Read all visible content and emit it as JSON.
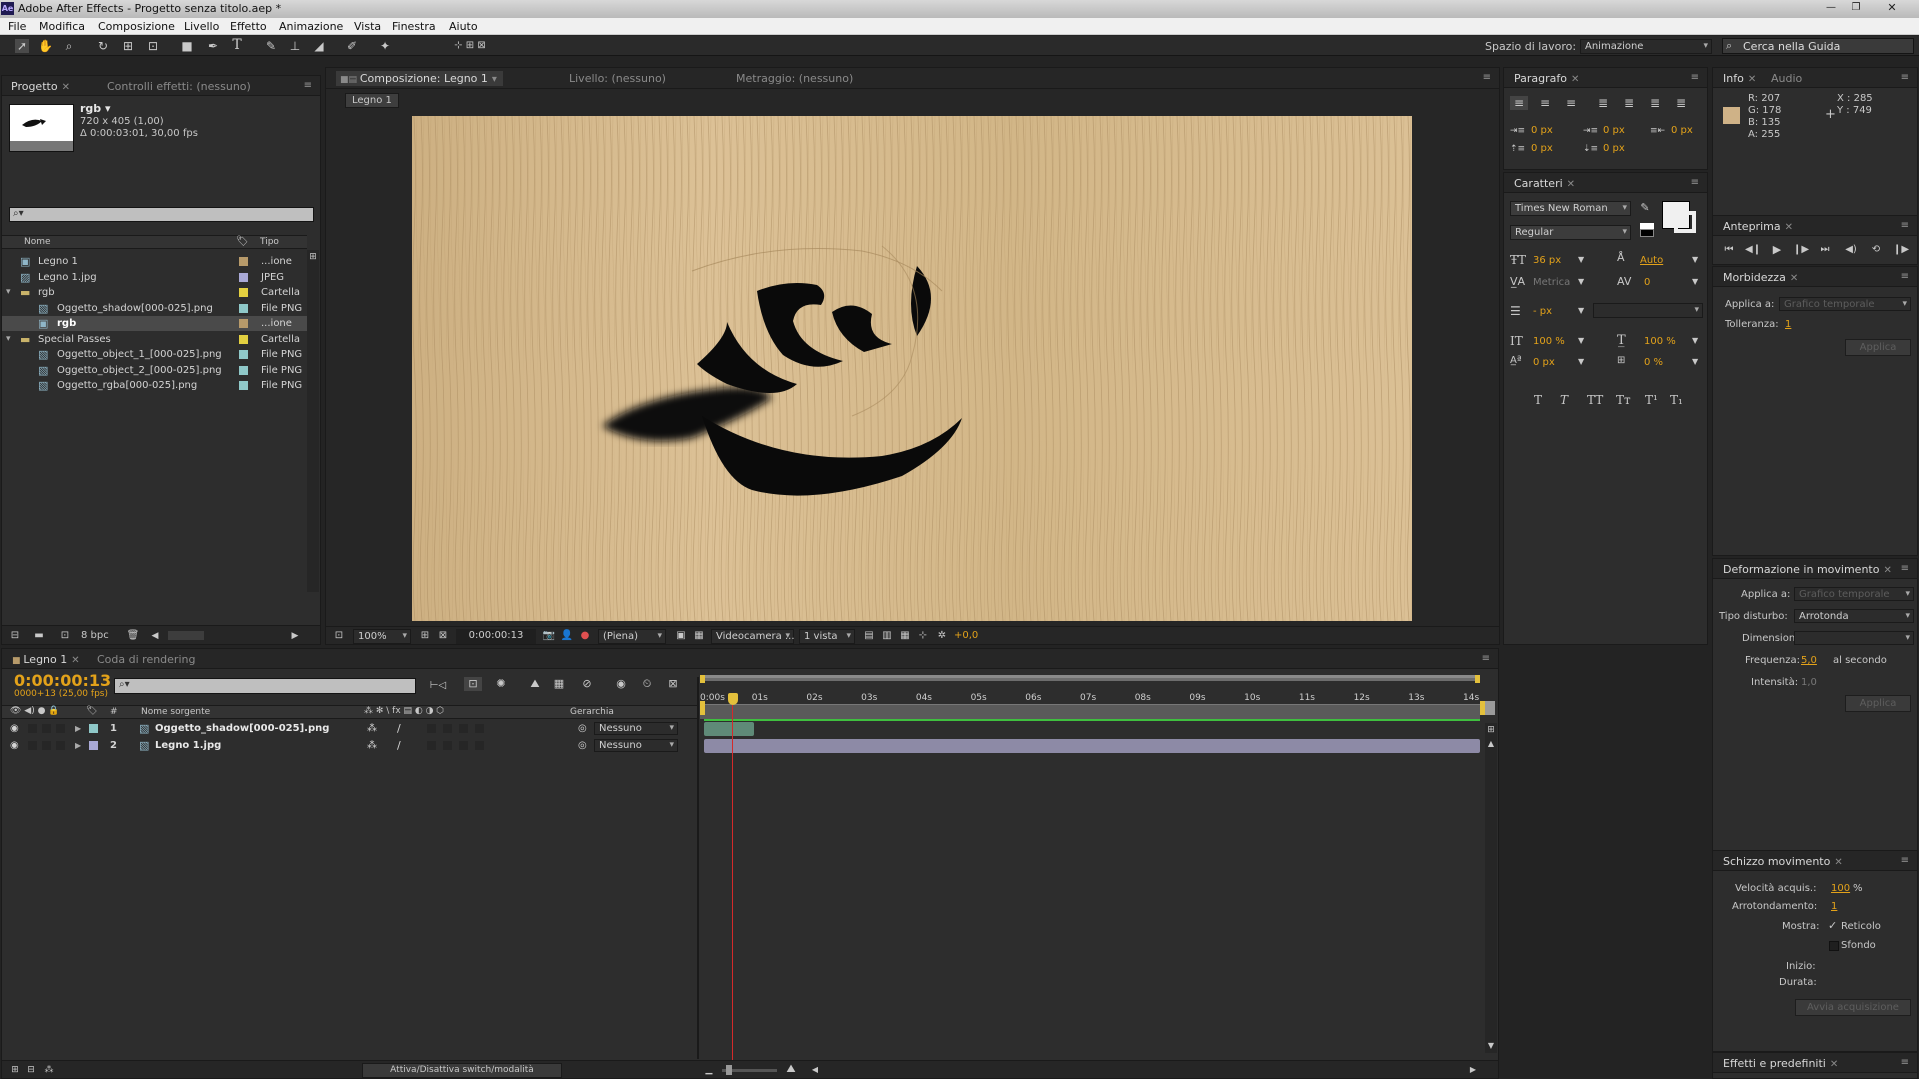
{
  "window": {
    "title": "Adobe After Effects - Progetto senza titolo.aep *",
    "app_icon": "Ae"
  },
  "menu": [
    "File",
    "Modifica",
    "Composizione",
    "Livello",
    "Effetto",
    "Animazione",
    "Vista",
    "Finestra",
    "Aiuto"
  ],
  "toolbar": {
    "workspace_label": "Spazio di lavoro:",
    "workspace_value": "Animazione",
    "search_placeholder": "Cerca nella Guida"
  },
  "project": {
    "tab": "Progetto",
    "tab2": "Controlli effetti: (nessuno)",
    "item_name": "rgb ▾",
    "item_dims": "720 x 405 (1,00)",
    "item_duration": "Δ 0:00:03:01, 30,00 fps",
    "col_name": "Nome",
    "col_type": "Tipo",
    "bpc": "8 bpc",
    "rows": [
      {
        "indent": 0,
        "name": "Legno 1",
        "type": "...ione",
        "color": "#b79a6a",
        "icon": "comp"
      },
      {
        "indent": 0,
        "name": "Legno 1.jpg",
        "type": "JPEG",
        "color": "#a9a9d6",
        "icon": "image"
      },
      {
        "indent": 0,
        "name": "rgb",
        "type": "Cartella",
        "color": "#e3d040",
        "icon": "folder",
        "twirl": "▾"
      },
      {
        "indent": 1,
        "name": "Oggetto_shadow[000-025].png",
        "type": "File PNG",
        "color": "#8fc8c8",
        "icon": "sequence"
      },
      {
        "indent": 1,
        "name": "rgb",
        "type": "...ione",
        "color": "#b79a6a",
        "icon": "comp",
        "selected": true
      },
      {
        "indent": 0,
        "name": "Special Passes",
        "type": "Cartella",
        "color": "#e3d040",
        "icon": "folder",
        "twirl": "▾"
      },
      {
        "indent": 1,
        "name": "Oggetto_object_1_[000-025].png",
        "type": "File PNG",
        "color": "#8fc8c8",
        "icon": "sequence"
      },
      {
        "indent": 1,
        "name": "Oggetto_object_2_[000-025].png",
        "type": "File PNG",
        "color": "#8fc8c8",
        "icon": "sequence"
      },
      {
        "indent": 1,
        "name": "Oggetto_rgba[000-025].png",
        "type": "File PNG",
        "color": "#8fc8c8",
        "icon": "sequence"
      }
    ]
  },
  "viewer": {
    "tab_comp": "Composizione: Legno 1",
    "tab_layer": "Livello: (nessuno)",
    "tab_footage": "Metraggio: (nessuno)",
    "breadcrumb": "Legno 1",
    "zoom": "100%",
    "timecode": "0:00:00:13",
    "resolution": "(Piena)",
    "camera": "Videocamera ...",
    "views": "1 vista",
    "exposure": "+0,0"
  },
  "paragraph": {
    "tab": "Paragrafo",
    "indent_left": "0 px",
    "indent_first": "0 px",
    "indent_right": "0 px",
    "space_before": "0 px",
    "space_after": "0 px"
  },
  "character": {
    "tab": "Caratteri",
    "font": "Times New Roman",
    "style": "Regular",
    "size": "36 px",
    "leading": "Auto",
    "kerning": "Metrica",
    "tracking": "0",
    "stroke": "- px",
    "v_scale": "100 %",
    "h_scale": "100 %",
    "baseline": "0 px",
    "tsume": "0 %",
    "fmt_buttons": [
      "T",
      "T",
      "TT",
      "Tт",
      "T¹",
      "T₁"
    ]
  },
  "info": {
    "tab": "Info",
    "tab2": "Audio",
    "r": "R: 207",
    "g": "G: 178",
    "b": "B: 135",
    "a": "A: 255",
    "x": "X : 285",
    "y": "Y : 749",
    "swatch": "#cfb287"
  },
  "preview": {
    "tab": "Anteprima"
  },
  "smoother": {
    "tab": "Morbidezza",
    "apply_to_label": "Applica a:",
    "apply_to": "Grafico temporale",
    "tolerance_label": "Tolleranza:",
    "tolerance": "1",
    "apply": "Applica"
  },
  "wiggler": {
    "tab": "Deformazione in movimento",
    "apply_to_label": "Applica a:",
    "apply_to": "Grafico temporale",
    "noise_label": "Tipo disturbo:",
    "noise": "Arrotonda",
    "dims_label": "Dimensioni:",
    "freq_label": "Frequenza:",
    "freq": "5,0",
    "freq_unit": "al secondo",
    "intensity_label": "Intensità:",
    "intensity": "1,0",
    "apply": "Applica"
  },
  "sketch": {
    "tab": "Schizzo movimento",
    "speed_label": "Velocità acquis.:",
    "speed": "100",
    "speed_unit": "%",
    "smooth_label": "Arrotondamento:",
    "smooth": "1",
    "show_label": "Mostra:",
    "wireframe": "Reticolo",
    "background": "Sfondo",
    "start_label": "Inizio:",
    "duration_label": "Durata:",
    "capture": "Avvia acquisizione"
  },
  "effects": {
    "tab": "Effetti e predefiniti"
  },
  "timeline": {
    "tab": "Legno 1",
    "tab2": "Coda di rendering",
    "timecode": "0:00:00:13",
    "frame_info": "0000+13 (25,00 fps)",
    "col_source": "Nome sorgente",
    "col_parent": "Gerarchia",
    "col_num": "#",
    "toggle_label": "Attiva/Disattiva switch/modalità",
    "ruler": [
      "0:00s",
      "01s",
      "02s",
      "03s",
      "04s",
      "05s",
      "06s",
      "07s",
      "08s",
      "09s",
      "10s",
      "11s",
      "12s",
      "13s",
      "14s"
    ],
    "current_time_sec": 0.52,
    "duration_sec": 14,
    "layers": [
      {
        "num": "1",
        "name": "Oggetto_shadow[000-025].png",
        "parent": "Nessuno",
        "color": "#8fc8c8",
        "bar_color": "#5f8a78",
        "bar_end_sec": 0.9
      },
      {
        "num": "2",
        "name": "Legno 1.jpg",
        "parent": "Nessuno",
        "color": "#a9a9d6",
        "bar_color": "#8d8aa6",
        "bar_end_sec": 14
      }
    ]
  }
}
